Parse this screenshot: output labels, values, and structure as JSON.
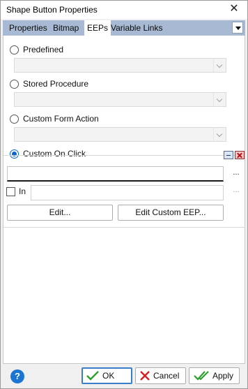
{
  "window": {
    "title": "Shape Button Properties"
  },
  "tabs": [
    {
      "label": "Properties"
    },
    {
      "label": "Bitmap"
    },
    {
      "label": "EEPs",
      "active": true
    },
    {
      "label": "Variable Links"
    }
  ],
  "options": {
    "predefined": {
      "label": "Predefined",
      "selected": false,
      "value": ""
    },
    "stored_procedure": {
      "label": "Stored Procedure",
      "selected": false,
      "value": ""
    },
    "custom_form_action": {
      "label": "Custom Form Action",
      "selected": false,
      "value": ""
    },
    "custom_on_click": {
      "label": "Custom On Click",
      "selected": true,
      "value": ""
    }
  },
  "in_field": {
    "label": "In",
    "checked": false,
    "value": ""
  },
  "ellipsis": "...",
  "buttons": {
    "edit": "Edit...",
    "edit_custom_eep": "Edit Custom EEP..."
  },
  "footer": {
    "help": "?",
    "ok": "OK",
    "cancel": "Cancel",
    "apply": "Apply"
  },
  "colors": {
    "tab_strip": "#a7b9d3",
    "selected_radio": "#0a63c9",
    "ok_check": "#2e9e2e",
    "cancel_x": "#d42020",
    "help": "#1a76d2"
  }
}
